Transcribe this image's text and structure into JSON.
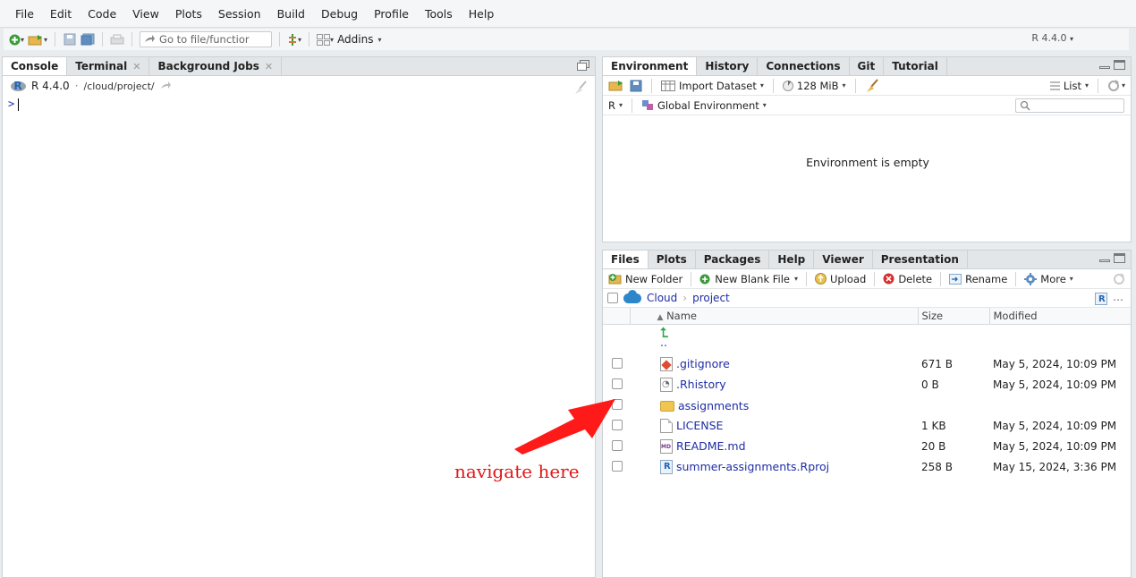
{
  "menu": [
    "File",
    "Edit",
    "Code",
    "View",
    "Plots",
    "Session",
    "Build",
    "Debug",
    "Profile",
    "Tools",
    "Help"
  ],
  "toolbar": {
    "goto_placeholder": "Go to file/functior",
    "addins_label": "Addins",
    "r_version": "R 4.4.0"
  },
  "console": {
    "tabs": [
      "Console",
      "Terminal",
      "Background Jobs"
    ],
    "r_version": "R 4.4.0",
    "path_sep": "·",
    "path": "/cloud/project/",
    "prompt": ">"
  },
  "environment": {
    "tabs": [
      "Environment",
      "History",
      "Connections",
      "Git",
      "Tutorial"
    ],
    "import_label": "Import Dataset",
    "memory": "128 MiB",
    "view_mode": "List",
    "language": "R",
    "scope": "Global Environment",
    "empty_message": "Environment is empty"
  },
  "files": {
    "tabs": [
      "Files",
      "Plots",
      "Packages",
      "Help",
      "Viewer",
      "Presentation"
    ],
    "actions": {
      "new_folder": "New Folder",
      "new_blank_file": "New Blank File",
      "upload": "Upload",
      "delete": "Delete",
      "rename": "Rename",
      "more": "More"
    },
    "breadcrumb": [
      "Cloud",
      "project"
    ],
    "headers": {
      "name": "Name",
      "size": "Size",
      "modified": "Modified"
    },
    "parent": "..",
    "rows": [
      {
        "name": ".gitignore",
        "size": "671 B",
        "modified": "May 5, 2024, 10:09 PM",
        "icon": "git-file-icon"
      },
      {
        "name": ".Rhistory",
        "size": "0 B",
        "modified": "May 5, 2024, 10:09 PM",
        "icon": "history-file-icon"
      },
      {
        "name": "assignments",
        "size": "",
        "modified": "",
        "icon": "folder-icon"
      },
      {
        "name": "LICENSE",
        "size": "1 KB",
        "modified": "May 5, 2024, 10:09 PM",
        "icon": "document-icon"
      },
      {
        "name": "README.md",
        "size": "20 B",
        "modified": "May 5, 2024, 10:09 PM",
        "icon": "markdown-file-icon"
      },
      {
        "name": "summer-assignments.Rproj",
        "size": "258 B",
        "modified": "May 15, 2024, 3:36 PM",
        "icon": "rproj-file-icon"
      }
    ]
  },
  "annotation": {
    "text": "navigate here",
    "color": "#e01818"
  }
}
